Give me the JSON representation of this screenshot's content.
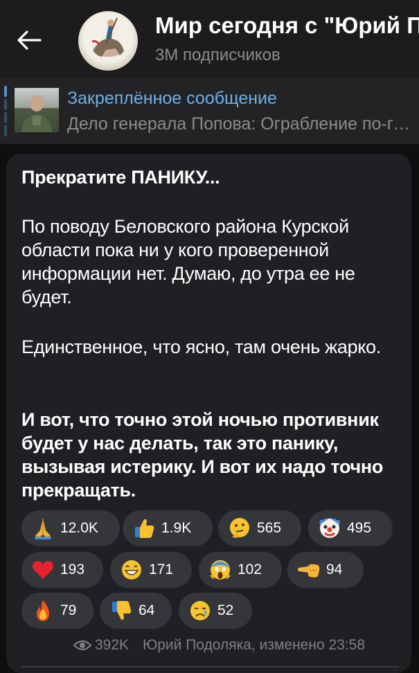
{
  "header": {
    "title": "Мир сегодня с \"Юрий Подоляка\"",
    "subtitle": "3M подписчиков"
  },
  "pinned": {
    "label": "Закреплённое сообщение",
    "text": "Дело генерала Попова: Ограбление по-генеральски"
  },
  "message": {
    "title": "Прекратите ПАНИКУ...",
    "paragraphs": [
      "По поводу Беловского района Курской области пока ни у кого проверенной информации нет. Думаю, до утра ее не будет.",
      "Единственное, что ясно, там очень жарко.",
      "И вот, что точно этой ночью противник будет у нас делать, так это панику, вызывая истерику. И вот их надо точно прекращать."
    ],
    "reactions": [
      {
        "emoji": "folded-hands",
        "count": "12.0K"
      },
      {
        "emoji": "thumbs-up",
        "count": "1.9K"
      },
      {
        "emoji": "thinking-face",
        "count": "565"
      },
      {
        "emoji": "clown-face",
        "count": "495"
      },
      {
        "emoji": "red-heart",
        "count": "193"
      },
      {
        "emoji": "grinning-face",
        "count": "171"
      },
      {
        "emoji": "screaming-face",
        "count": "102"
      },
      {
        "emoji": "pointing-hand",
        "count": "94"
      },
      {
        "emoji": "fire",
        "count": "79"
      },
      {
        "emoji": "thumbs-down",
        "count": "64"
      },
      {
        "emoji": "crying-face",
        "count": "52"
      }
    ],
    "views": "392K",
    "author_line": "Юрий Подоляка, изменено 23:58"
  },
  "colors": {
    "header_bg": "#1c1c1e",
    "bubble_bg": "#1f2023",
    "accent": "#6cb0ea",
    "muted": "#8c8c90"
  }
}
